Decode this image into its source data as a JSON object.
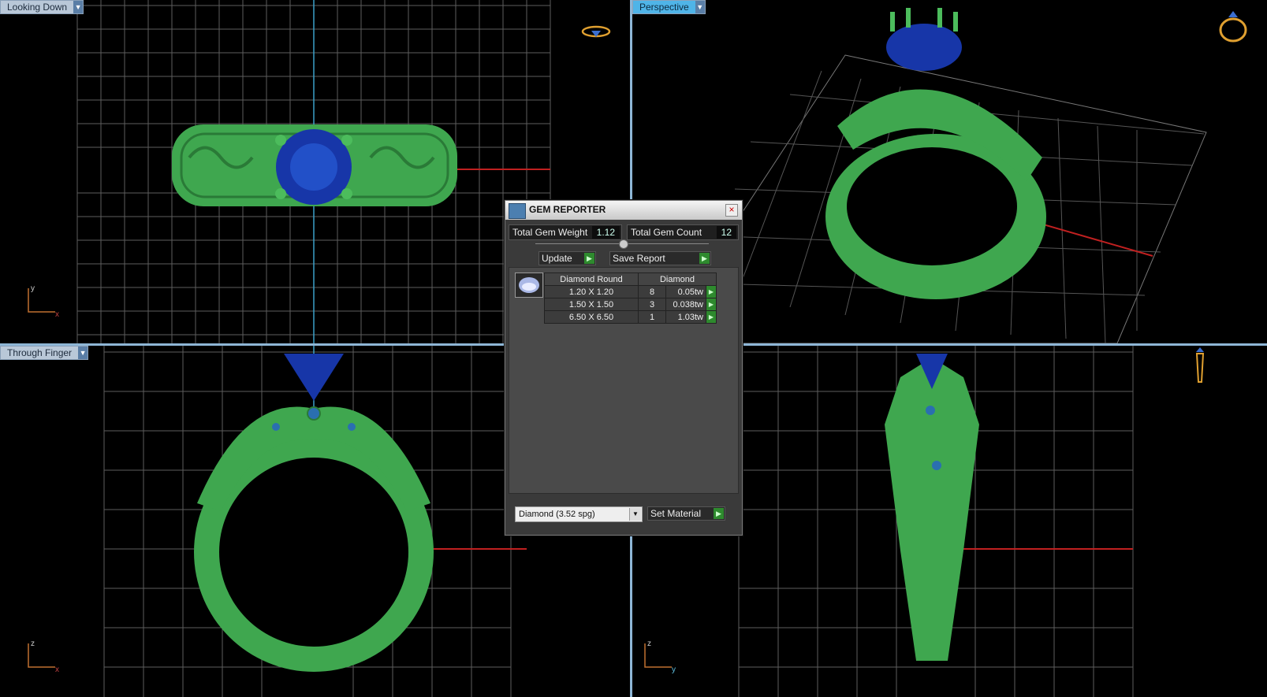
{
  "viewports": {
    "top_left": {
      "label": "Looking Down",
      "axes": [
        "y",
        "x"
      ]
    },
    "top_right": {
      "label": "Perspective"
    },
    "bottom_left": {
      "label": "Through Finger",
      "axes": [
        "z",
        "x"
      ]
    },
    "bottom_right": {
      "axes": [
        "z",
        "y"
      ]
    }
  },
  "gem_reporter": {
    "title": "GEM REPORTER",
    "close_icon": "×",
    "total_weight_label": "Total Gem Weight",
    "total_weight": "1.12",
    "total_count_label": "Total Gem Count",
    "total_count": "12",
    "update_label": "Update",
    "save_label": "Save Report",
    "arrow": "▶",
    "table": {
      "headers": [
        "Diamond Round",
        "Diamond"
      ],
      "rows": [
        {
          "size": "1.20 X 1.20",
          "count": "8",
          "weight": "0.05tw"
        },
        {
          "size": "1.50 X 1.50",
          "count": "3",
          "weight": "0.038tw"
        },
        {
          "size": "6.50 X 6.50",
          "count": "1",
          "weight": "1.03tw"
        }
      ]
    },
    "material": "Diamond    (3.52 spg)",
    "set_material_label": "Set Material"
  },
  "colors": {
    "metal": "#3fa74f",
    "gem": "#1736a8",
    "grid": "#6a6a6a",
    "accent": "#4fb4e8"
  }
}
